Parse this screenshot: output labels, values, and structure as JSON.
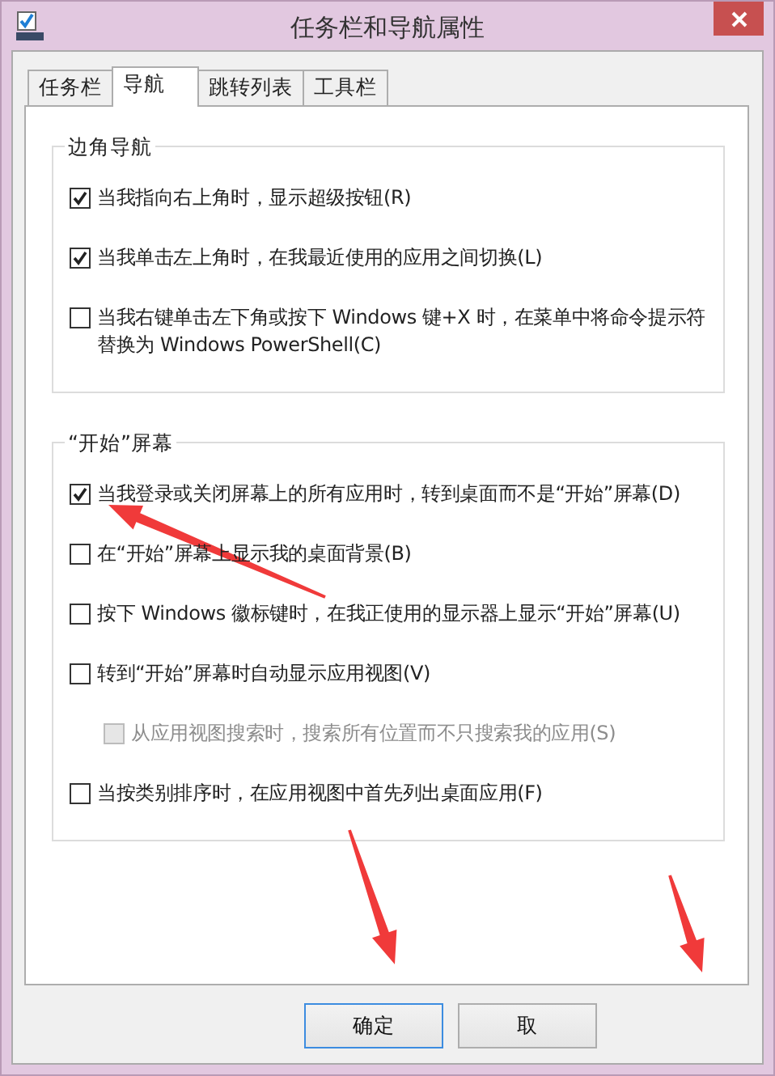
{
  "window": {
    "title": "任务栏和导航属性"
  },
  "tabs": [
    {
      "label": "任务栏",
      "selected": false
    },
    {
      "label": "导航",
      "selected": true
    },
    {
      "label": "跳转列表",
      "selected": false
    },
    {
      "label": "工具栏",
      "selected": false
    }
  ],
  "groups": [
    {
      "title": "边角导航",
      "options": [
        {
          "label": "当我指向右上角时，显示超级按钮(R)",
          "checked": true,
          "disabled": false
        },
        {
          "label": "当我单击左上角时，在我最近使用的应用之间切换(L)",
          "checked": true,
          "disabled": false
        },
        {
          "label": "当我右键单击左下角或按下 Windows 键+X 时，在菜单中将命令提示符替换为 Windows PowerShell(C)",
          "checked": false,
          "disabled": false
        }
      ]
    },
    {
      "title": "“开始”屏幕",
      "options": [
        {
          "label": "当我登录或关闭屏幕上的所有应用时，转到桌面而不是“开始”屏幕(D)",
          "checked": true,
          "disabled": false
        },
        {
          "label": "在“开始”屏幕上显示我的桌面背景(B)",
          "checked": false,
          "disabled": false
        },
        {
          "label": "按下 Windows 徽标键时，在我正使用的显示器上显示“开始”屏幕(U)",
          "checked": false,
          "disabled": false
        },
        {
          "label": "转到“开始”屏幕时自动显示应用视图(V)",
          "checked": false,
          "disabled": false,
          "children": [
            {
              "label": "从应用视图搜索时，搜索所有位置而不只搜索我的应用(S)",
              "checked": false,
              "disabled": true
            }
          ]
        },
        {
          "label": "当按类别排序时，在应用视图中首先列出桌面应用(F)",
          "checked": false,
          "disabled": false
        }
      ]
    }
  ],
  "buttons": [
    {
      "label": "确定",
      "focused": true
    },
    {
      "label": "取",
      "focused": false
    }
  ]
}
